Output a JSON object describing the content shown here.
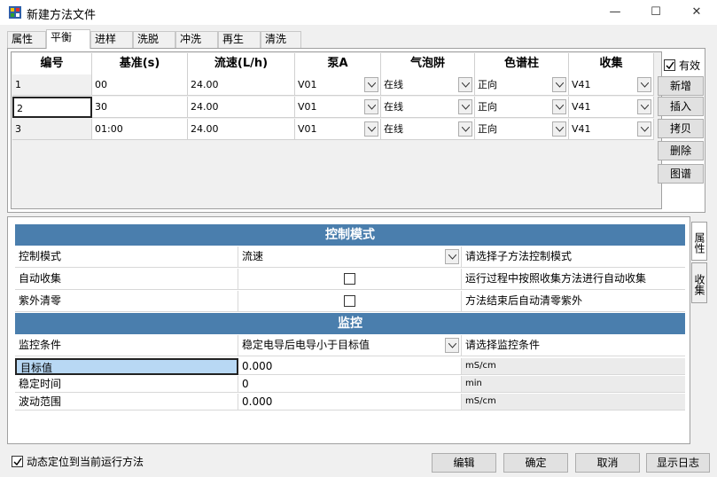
{
  "window": {
    "title": "新建方法文件",
    "minimize": "—",
    "maximize": "☐",
    "close": "✕"
  },
  "tabs": [
    "属性",
    "平衡",
    "进样",
    "洗脱",
    "冲洗",
    "再生",
    "清洗"
  ],
  "active_tab": "平衡",
  "grid": {
    "headers": [
      "编号",
      "基准(s)",
      "流速(L/h)",
      "泵A",
      "气泡阱",
      "色谱柱",
      "收集"
    ],
    "rows": [
      {
        "no": "1",
        "base": "00",
        "flow": "24.00",
        "pump": "V01",
        "bubble": "在线",
        "column": "正向",
        "collect": "V41"
      },
      {
        "no": "2",
        "base": "30",
        "flow": "24.00",
        "pump": "V01",
        "bubble": "在线",
        "column": "正向",
        "collect": "V41"
      },
      {
        "no": "3",
        "base": "01:00",
        "flow": "24.00",
        "pump": "V01",
        "bubble": "在线",
        "column": "正向",
        "collect": "V41"
      }
    ]
  },
  "side": {
    "valid_label": "有效",
    "valid_checked": true,
    "buttons": [
      "新增",
      "插入",
      "拷贝",
      "删除",
      "图谱"
    ]
  },
  "props": {
    "section1_title": "控制模式",
    "section2_title": "监控",
    "rows1": [
      {
        "label": "控制模式",
        "value": "流速",
        "desc": "请选择子方法控制模式"
      },
      {
        "label": "自动收集",
        "value": "",
        "desc": "运行过程中按照收集方法进行自动收集"
      },
      {
        "label": "紫外清零",
        "value": "",
        "desc": "方法结束后自动清零紫外"
      }
    ],
    "rows2": [
      {
        "label": "监控条件",
        "value": "稳定电导后电导小于目标值",
        "desc": "请选择监控条件"
      },
      {
        "label": "目标值",
        "value": "0.000",
        "unit": "mS/cm"
      },
      {
        "label": "稳定时间",
        "value": "0",
        "unit": "min"
      },
      {
        "label": "波动范围",
        "value": "0.000",
        "unit": "mS/cm"
      }
    ]
  },
  "side_tabs": [
    "属性",
    "收集"
  ],
  "footer": {
    "auto_locate_label": "动态定位到当前运行方法",
    "auto_locate_checked": true,
    "buttons": [
      "编辑",
      "确定",
      "取消",
      "显示日志"
    ]
  }
}
